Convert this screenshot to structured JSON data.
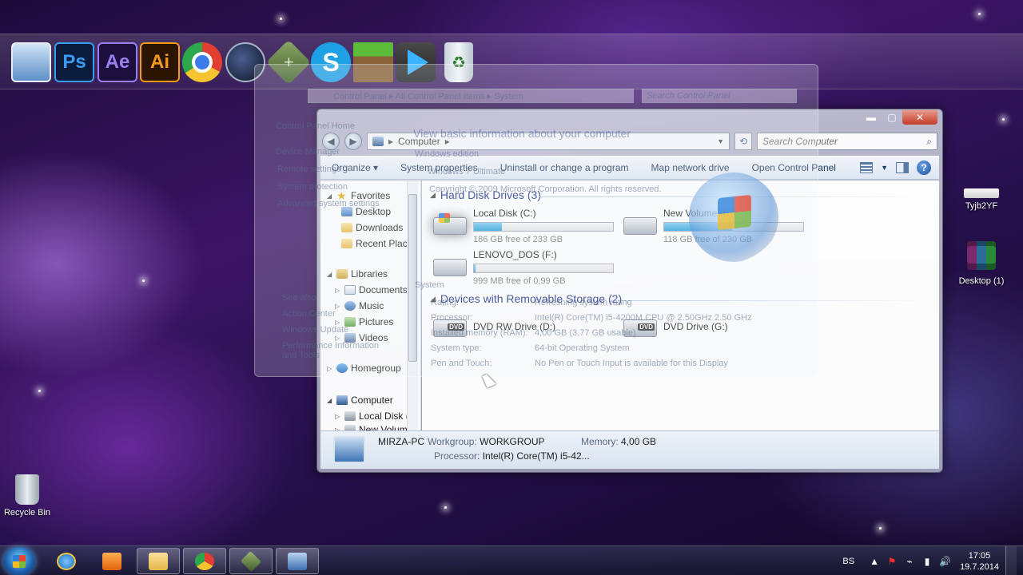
{
  "desktop": {
    "icons": [
      {
        "label": "Tyjb2YF"
      },
      {
        "label": "Desktop (1)"
      },
      {
        "label": "Recycle Bin"
      }
    ]
  },
  "dock": {
    "items": [
      {
        "name": "computer",
        "icon": "computer-icon"
      },
      {
        "name": "photoshop",
        "glyph": "Ps",
        "color": "#3a9cf0"
      },
      {
        "name": "after-effects",
        "glyph": "Ae",
        "color": "#9b7ef0"
      },
      {
        "name": "illustrator",
        "glyph": "Ai",
        "color": "#f39a16"
      },
      {
        "name": "chrome",
        "icon": "chrome-icon"
      },
      {
        "name": "cinema-4d",
        "icon": "cinema4d-icon"
      },
      {
        "name": "camtasia",
        "glyph": "✕"
      },
      {
        "name": "skype",
        "glyph": "S"
      },
      {
        "name": "minecraft",
        "icon": "minecraft-icon"
      },
      {
        "name": "media-player",
        "icon": "play-icon"
      },
      {
        "name": "recycle-bin",
        "glyph": "♻"
      }
    ]
  },
  "ghost_window": {
    "address": [
      "Control Panel",
      "All Control Panel Items",
      "System"
    ],
    "search_placeholder": "Search Control Panel",
    "left_links": [
      "Control Panel Home",
      "Device Manager",
      "Remote settings",
      "System protection",
      "Advanced system settings"
    ],
    "see_also_title": "See also",
    "see_also": [
      "Action Center",
      "Windows Update",
      "Performance Information and Tools"
    ],
    "heading": "View basic information about your computer",
    "edition_title": "Windows edition",
    "edition": "Windows 7 Ultimate",
    "copyright": "Copyright © 2009 Microsoft Corporation.  All rights reserved.",
    "system_title": "System",
    "rows": [
      {
        "label": "Rating:",
        "value": "Refreshing system rating"
      },
      {
        "label": "Processor:",
        "value": "Intel(R) Core(TM) i5-4200M CPU @ 2.50GHz   2.50 GHz"
      },
      {
        "label": "Installed memory (RAM):",
        "value": "4,00 GB (3,77 GB usable)"
      },
      {
        "label": "System type:",
        "value": "64-bit Operating System"
      },
      {
        "label": "Pen and Touch:",
        "value": "No Pen or Touch Input is available for this Display"
      }
    ]
  },
  "explorer": {
    "address": [
      "Computer"
    ],
    "search_placeholder": "Search Computer",
    "toolbar": {
      "organize": "Organize",
      "system_properties": "System properties",
      "uninstall": "Uninstall or change a program",
      "map_drive": "Map network drive",
      "open_control_panel": "Open Control Panel"
    },
    "nav": {
      "favorites": "Favorites",
      "desktop": "Desktop",
      "downloads": "Downloads",
      "recent": "Recent Place",
      "libraries": "Libraries",
      "documents": "Documents",
      "music": "Music",
      "pictures": "Pictures",
      "videos": "Videos",
      "homegroup": "Homegroup",
      "computer": "Computer",
      "local_disk": "Local Disk (C",
      "new_volume": "New Volum"
    },
    "hdd_group": "Hard Disk Drives (3)",
    "removable_group": "Devices with Removable Storage (2)",
    "drives": [
      {
        "name": "Local Disk (C:)",
        "free": "186 GB free of 233 GB",
        "used_fraction": 0.2,
        "icon": "windows-drive-icon"
      },
      {
        "name": "New Volume (E:)",
        "free": "118 GB free of 230 GB",
        "used_fraction": 0.49,
        "icon": "hard-drive-icon"
      },
      {
        "name": "LENOVO_DOS (F:)",
        "free": "999 MB free of 0,99 GB",
        "used_fraction": 0.01,
        "icon": "hard-drive-icon"
      }
    ],
    "removable": [
      {
        "name": "DVD RW Drive (D:)",
        "icon": "dvd-drive-icon"
      },
      {
        "name": "DVD Drive (G:)",
        "icon": "dvd-drive-icon"
      }
    ],
    "details": {
      "pc_name": "MIRZA-PC",
      "workgroup_label": "Workgroup:",
      "workgroup": "WORKGROUP",
      "memory_label": "Memory:",
      "memory": "4,00 GB",
      "processor_label": "Processor:",
      "processor": "Intel(R) Core(TM) i5-42..."
    }
  },
  "taskbar": {
    "language": "BS",
    "time": "17:05",
    "date": "19.7.2014"
  }
}
